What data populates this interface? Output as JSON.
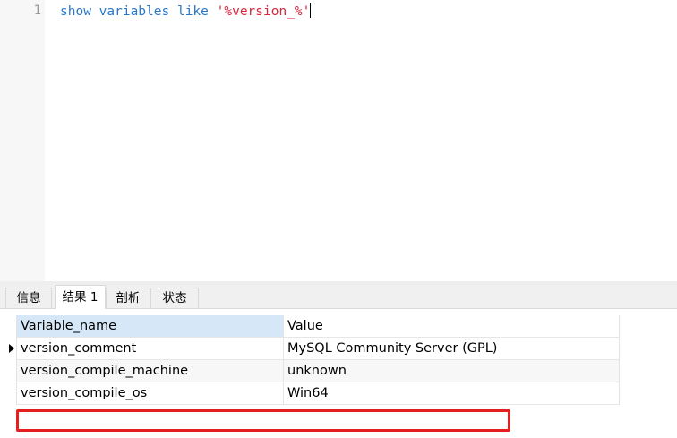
{
  "editor": {
    "line_number": "1",
    "query": {
      "kw_show": "show",
      "kw_variables": "variables",
      "kw_like": "like",
      "pattern": "'%version_%'"
    }
  },
  "results_panel": {
    "tabs": [
      {
        "label": "信息",
        "active": false
      },
      {
        "label": "结果 1",
        "active": true
      },
      {
        "label": "剖析",
        "active": false
      },
      {
        "label": "状态",
        "active": false
      }
    ],
    "grid": {
      "columns": [
        "Variable_name",
        "Value"
      ],
      "rows": [
        {
          "name": "version_comment",
          "value": "MySQL Community Server (GPL)"
        },
        {
          "name": "version_compile_machine",
          "value": "unknown"
        },
        {
          "name": "version_compile_os",
          "value": "Win64"
        }
      ],
      "current_row_index": 0,
      "highlighted_row_index": 2
    }
  },
  "colors": {
    "keyword": "#2b77c7",
    "string": "#d4283c",
    "highlight_border": "#e51f1f",
    "header_selected": "#d6e8f8"
  }
}
